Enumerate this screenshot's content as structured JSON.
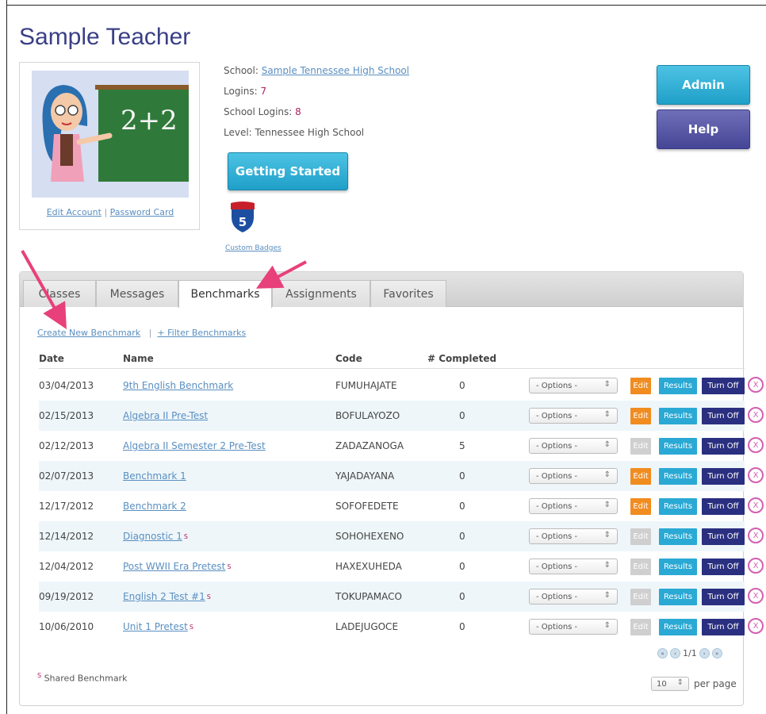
{
  "page": {
    "title": "Sample Teacher"
  },
  "profile": {
    "edit_account": "Edit Account",
    "separator": "|",
    "password_card": "Password Card"
  },
  "info": {
    "school_label": "School:",
    "school_name": "Sample Tennessee High School",
    "logins_label": "Logins:",
    "logins": "7",
    "school_logins_label": "School Logins:",
    "school_logins": "8",
    "level_label": "Level:",
    "level": "Tennessee High School"
  },
  "buttons": {
    "getting_started": "Getting Started",
    "admin": "Admin",
    "help": "Help"
  },
  "badge": {
    "label": "Custom Badges",
    "number": "5"
  },
  "tabs": [
    {
      "label": "Classes"
    },
    {
      "label": "Messages"
    },
    {
      "label": "Benchmarks"
    },
    {
      "label": "Assignments"
    },
    {
      "label": "Favorites"
    }
  ],
  "actions": {
    "create": "Create New Benchmark",
    "separator": "|",
    "filter": "+ Filter Benchmarks"
  },
  "table": {
    "headers": [
      "Date",
      "Name",
      "Code",
      "# Completed"
    ],
    "options_label": "- Options -",
    "edit_label": "Edit",
    "results_label": "Results",
    "turnoff_label": "Turn Off",
    "remove_label": "X",
    "rows": [
      {
        "date": "03/04/2013",
        "name": "9th English Benchmark",
        "shared": "",
        "code": "FUMUHAJATE",
        "completed": "0"
      },
      {
        "date": "02/15/2013",
        "name": "Algebra II Pre-Test",
        "shared": "",
        "code": "BOFULAYOZO",
        "completed": "0"
      },
      {
        "date": "02/12/2013",
        "name": "Algebra II Semester 2 Pre-Test",
        "shared": "",
        "code": "ZADAZANOGA",
        "completed": "5"
      },
      {
        "date": "02/07/2013",
        "name": "Benchmark 1",
        "shared": "",
        "code": "YAJADAYANA",
        "completed": "0"
      },
      {
        "date": "12/17/2012",
        "name": "Benchmark 2",
        "shared": "",
        "code": "SOFOFEDETE",
        "completed": "0"
      },
      {
        "date": "12/14/2012",
        "name": "Diagnostic 1",
        "shared": "S",
        "code": "SOHOHEXENO",
        "completed": "0"
      },
      {
        "date": "12/04/2012",
        "name": "Post WWII Era Pretest",
        "shared": "S",
        "code": "HAXEXUHEDA",
        "completed": "0"
      },
      {
        "date": "09/19/2012",
        "name": "English 2 Test #1",
        "shared": "S",
        "code": "TOKUPAMACO",
        "completed": "0"
      },
      {
        "date": "10/06/2010",
        "name": "Unit 1 Pretest",
        "shared": "S",
        "code": "LADEJUGOCE",
        "completed": "0"
      }
    ]
  },
  "pagination": {
    "text": "1/1"
  },
  "footer": {
    "shared_mark": "S",
    "shared_note": "Shared Benchmark",
    "per_page_value": "10",
    "per_page_label": "per page"
  },
  "colors": {
    "title": "#3a3f86",
    "link": "#5a8fc0",
    "accent_cyan": "#2aa9d4",
    "accent_navy": "#2a2f80",
    "edit_orange": "#f08c20",
    "annotation_pink": "#e8407a"
  }
}
